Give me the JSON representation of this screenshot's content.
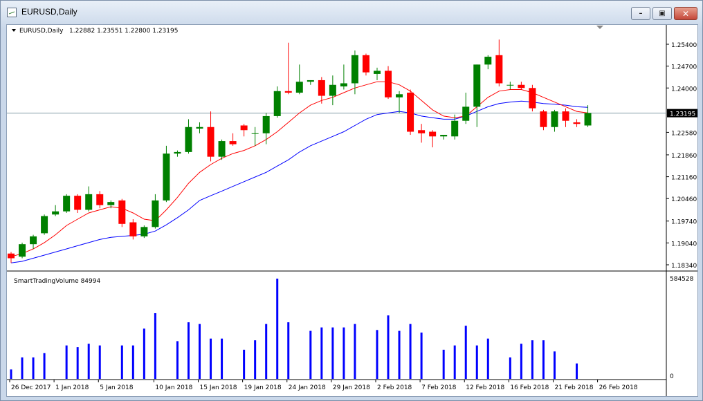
{
  "window": {
    "title": "EURUSD,Daily",
    "buttons": [
      "minimize",
      "maximize",
      "close"
    ]
  },
  "header": {
    "symbol": "EURUSD,Daily",
    "ohlc": "1.22882 1.23551 1.22800 1.23195"
  },
  "indicator": {
    "label": "SmartTradingVolume 84994",
    "max_label": "584528",
    "zero_label": "0"
  },
  "price_labels": [
    "1.25400",
    "1.24700",
    "1.24000",
    "1.23195",
    "1.22580",
    "1.21860",
    "1.21160",
    "1.20460",
    "1.19740",
    "1.19040",
    "1.18340"
  ],
  "date_labels": [
    "26 Dec 2017",
    "1 Jan 2018",
    "5 Jan 2018",
    "10 Jan 2018",
    "15 Jan 2018",
    "19 Jan 2018",
    "24 Jan 2018",
    "29 Jan 2018",
    "2 Feb 2018",
    "7 Feb 2018",
    "12 Feb 2018",
    "16 Feb 2018",
    "21 Feb 2018",
    "26 Feb 2018"
  ],
  "colors": {
    "bull": "#008000",
    "bear": "#ff0000",
    "ma_fast": "#ff0000",
    "ma_slow": "#0000ff",
    "volume": "#0000ff",
    "current_line": "#7f9aa5"
  },
  "chart_data": [
    {
      "type": "candlestick",
      "title": "EURUSD,Daily",
      "current_price": 1.23195,
      "ylim": [
        1.1825,
        1.2575
      ],
      "candles": [
        {
          "o": 1.187,
          "h": 1.1875,
          "l": 1.184,
          "c": 1.1855
        },
        {
          "o": 1.186,
          "h": 1.1905,
          "l": 1.1855,
          "c": 1.19
        },
        {
          "o": 1.19,
          "h": 1.193,
          "l": 1.1885,
          "c": 1.1925
        },
        {
          "o": 1.1935,
          "h": 1.1995,
          "l": 1.193,
          "c": 1.199
        },
        {
          "o": 1.1995,
          "h": 1.2025,
          "l": 1.199,
          "c": 1.2005
        },
        {
          "o": 1.2005,
          "h": 1.206,
          "l": 1.2,
          "c": 1.2055
        },
        {
          "o": 1.2055,
          "h": 1.206,
          "l": 1.2,
          "c": 1.201
        },
        {
          "o": 1.201,
          "h": 1.2085,
          "l": 1.2005,
          "c": 1.206
        },
        {
          "o": 1.206,
          "h": 1.207,
          "l": 1.2015,
          "c": 1.2025
        },
        {
          "o": 1.2025,
          "h": 1.204,
          "l": 1.2015,
          "c": 1.2035
        },
        {
          "o": 1.204,
          "h": 1.2045,
          "l": 1.1955,
          "c": 1.1965
        },
        {
          "o": 1.197,
          "h": 1.198,
          "l": 1.1915,
          "c": 1.1925
        },
        {
          "o": 1.1925,
          "h": 1.196,
          "l": 1.192,
          "c": 1.1955
        },
        {
          "o": 1.1955,
          "h": 1.206,
          "l": 1.195,
          "c": 1.204
        },
        {
          "o": 1.204,
          "h": 1.2215,
          "l": 1.2035,
          "c": 1.219
        },
        {
          "o": 1.219,
          "h": 1.22,
          "l": 1.218,
          "c": 1.2195
        },
        {
          "o": 1.2195,
          "h": 1.23,
          "l": 1.219,
          "c": 1.2275
        },
        {
          "o": 1.227,
          "h": 1.229,
          "l": 1.2255,
          "c": 1.2275
        },
        {
          "o": 1.2275,
          "h": 1.2325,
          "l": 1.2165,
          "c": 1.218
        },
        {
          "o": 1.218,
          "h": 1.2235,
          "l": 1.217,
          "c": 1.223
        },
        {
          "o": 1.223,
          "h": 1.2255,
          "l": 1.2215,
          "c": 1.222
        },
        {
          "o": 1.228,
          "h": 1.2285,
          "l": 1.2245,
          "c": 1.2265
        },
        {
          "o": 1.2255,
          "h": 1.2275,
          "l": 1.2215,
          "c": 1.2255
        },
        {
          "o": 1.2255,
          "h": 1.232,
          "l": 1.222,
          "c": 1.231
        },
        {
          "o": 1.231,
          "h": 1.2405,
          "l": 1.2305,
          "c": 1.239
        },
        {
          "o": 1.239,
          "h": 1.2545,
          "l": 1.238,
          "c": 1.2385
        },
        {
          "o": 1.2385,
          "h": 1.2475,
          "l": 1.238,
          "c": 1.242
        },
        {
          "o": 1.242,
          "h": 1.2425,
          "l": 1.241,
          "c": 1.2425
        },
        {
          "o": 1.2425,
          "h": 1.2435,
          "l": 1.235,
          "c": 1.2375
        },
        {
          "o": 1.2375,
          "h": 1.244,
          "l": 1.2345,
          "c": 1.241
        },
        {
          "o": 1.2405,
          "h": 1.2475,
          "l": 1.2395,
          "c": 1.2415
        },
        {
          "o": 1.2415,
          "h": 1.252,
          "l": 1.238,
          "c": 1.2505
        },
        {
          "o": 1.2505,
          "h": 1.251,
          "l": 1.244,
          "c": 1.245
        },
        {
          "o": 1.2445,
          "h": 1.2465,
          "l": 1.2425,
          "c": 1.2455
        },
        {
          "o": 1.2455,
          "h": 1.247,
          "l": 1.2365,
          "c": 1.237
        },
        {
          "o": 1.237,
          "h": 1.239,
          "l": 1.232,
          "c": 1.238
        },
        {
          "o": 1.2385,
          "h": 1.2395,
          "l": 1.225,
          "c": 1.226
        },
        {
          "o": 1.2265,
          "h": 1.2285,
          "l": 1.2225,
          "c": 1.2255
        },
        {
          "o": 1.226,
          "h": 1.2265,
          "l": 1.221,
          "c": 1.2245
        },
        {
          "o": 1.2245,
          "h": 1.225,
          "l": 1.2235,
          "c": 1.225
        },
        {
          "o": 1.2245,
          "h": 1.2315,
          "l": 1.2235,
          "c": 1.2295
        },
        {
          "o": 1.2295,
          "h": 1.2385,
          "l": 1.2285,
          "c": 1.234
        },
        {
          "o": 1.234,
          "h": 1.2475,
          "l": 1.2275,
          "c": 1.2475
        },
        {
          "o": 1.2475,
          "h": 1.2505,
          "l": 1.246,
          "c": 1.25
        },
        {
          "o": 1.2505,
          "h": 1.2555,
          "l": 1.2405,
          "c": 1.2415
        },
        {
          "o": 1.241,
          "h": 1.242,
          "l": 1.2395,
          "c": 1.241
        },
        {
          "o": 1.241,
          "h": 1.242,
          "l": 1.2395,
          "c": 1.24
        },
        {
          "o": 1.24,
          "h": 1.241,
          "l": 1.2325,
          "c": 1.2335
        },
        {
          "o": 1.2325,
          "h": 1.233,
          "l": 1.2265,
          "c": 1.2275
        },
        {
          "o": 1.2275,
          "h": 1.233,
          "l": 1.226,
          "c": 1.2325
        },
        {
          "o": 1.2325,
          "h": 1.2335,
          "l": 1.2275,
          "c": 1.2295
        },
        {
          "o": 1.229,
          "h": 1.23,
          "l": 1.2275,
          "c": 1.2285
        },
        {
          "o": 1.228,
          "h": 1.2345,
          "l": 1.2275,
          "c": 1.232
        }
      ],
      "ma_fast": [
        1.186,
        1.187,
        1.1885,
        1.1905,
        1.193,
        1.196,
        1.198,
        1.2,
        1.201,
        1.202,
        1.2015,
        1.2,
        1.198,
        1.1975,
        1.201,
        1.205,
        1.2095,
        1.213,
        1.2155,
        1.2175,
        1.219,
        1.22,
        1.2215,
        1.2235,
        1.226,
        1.229,
        1.232,
        1.2345,
        1.236,
        1.237,
        1.2385,
        1.24,
        1.241,
        1.242,
        1.242,
        1.241,
        1.239,
        1.236,
        1.233,
        1.231,
        1.2305,
        1.231,
        1.234,
        1.237,
        1.239,
        1.2395,
        1.2395,
        1.2385,
        1.237,
        1.2355,
        1.234,
        1.2325,
        1.232
      ],
      "ma_slow": [
        1.184,
        1.1845,
        1.1855,
        1.1865,
        1.1875,
        1.1885,
        1.1895,
        1.1905,
        1.1915,
        1.1922,
        1.1925,
        1.1928,
        1.1932,
        1.1942,
        1.1962,
        1.1985,
        1.201,
        1.204,
        1.2055,
        1.207,
        1.2085,
        1.21,
        1.2115,
        1.213,
        1.215,
        1.217,
        1.2195,
        1.2215,
        1.223,
        1.2245,
        1.226,
        1.228,
        1.23,
        1.2315,
        1.232,
        1.2325,
        1.232,
        1.231,
        1.2305,
        1.23,
        1.23,
        1.231,
        1.2325,
        1.234,
        1.235,
        1.2355,
        1.2358,
        1.2355,
        1.235,
        1.2348,
        1.2345,
        1.234,
        1.2338
      ]
    },
    {
      "type": "bar",
      "title": "SmartTradingVolume 84994",
      "ylim": [
        0,
        584528
      ],
      "values": [
        55000,
        125000,
        125000,
        150000,
        0,
        195000,
        185000,
        205000,
        195000,
        0,
        195000,
        195000,
        293000,
        383000,
        0,
        220000,
        330000,
        320000,
        235000,
        235000,
        0,
        170000,
        225000,
        320000,
        584528,
        330000,
        0,
        280000,
        300000,
        300000,
        300000,
        320000,
        0,
        285000,
        370000,
        280000,
        320000,
        270000,
        0,
        170000,
        195000,
        310000,
        195000,
        235000,
        0,
        125000,
        205000,
        225000,
        225000,
        160000,
        0,
        90000,
        0
      ]
    }
  ]
}
